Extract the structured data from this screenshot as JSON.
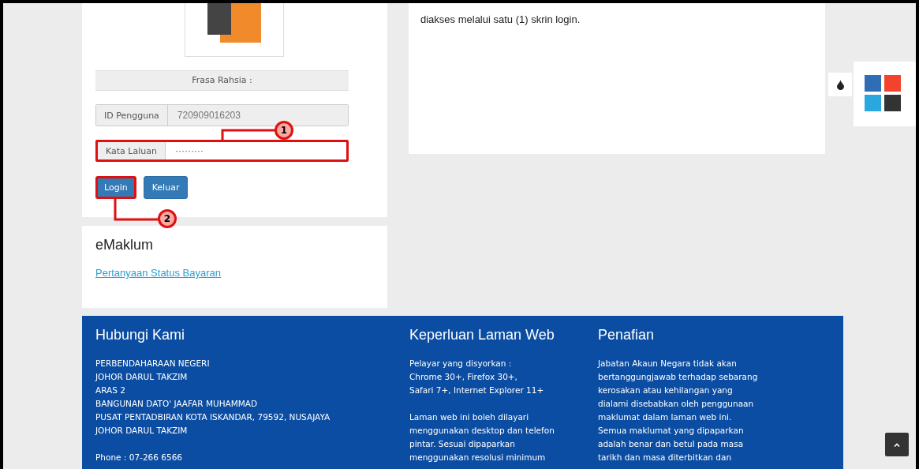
{
  "login": {
    "secret_phrase_label": "Frasa Rahsia :",
    "fields": [
      {
        "label": "ID Pengguna",
        "value": "720909016203",
        "readonly": true,
        "highlighted": false
      },
      {
        "label": "Kata Laluan",
        "value": "·········",
        "readonly": false,
        "highlighted": true,
        "callout": {
          "number": "1",
          "kind": "above"
        }
      }
    ],
    "buttons": [
      {
        "label": "Login",
        "highlighted": true,
        "callout": {
          "number": "2",
          "kind": "below"
        }
      },
      {
        "label": "Keluar",
        "highlighted": false
      }
    ]
  },
  "intro": {
    "text": "diakses melalui satu (1) skrin login."
  },
  "emaklum": {
    "title": "eMaklum",
    "link": "Pertanyaan Status Bayaran"
  },
  "color_switcher": {
    "swatches": [
      {
        "color": "#2f6db5",
        "selected": false
      },
      {
        "color": "#f4432c",
        "selected": false
      },
      {
        "color": "#29a8e0",
        "selected": false
      },
      {
        "color": "#333333",
        "selected": false
      }
    ]
  },
  "footer": {
    "columns": [
      {
        "title": "Hubungi Kami",
        "paragraphs": [
          [
            "PERBENDAHARAAN NEGERI",
            "JOHOR DARUL TAKZIM",
            "ARAS 2",
            "BANGUNAN DATO' JAAFAR MUHAMMAD",
            "PUSAT PENTADBIRAN KOTA ISKANDAR, 79592, NUSAJAYA",
            "JOHOR DARUL TAKZIM"
          ],
          [
            "Phone : 07-266 6566"
          ]
        ]
      },
      {
        "title": "Keperluan Laman Web",
        "paragraphs": [
          [
            "Pelayar yang disyorkan :",
            "Chrome 30+, Firefox 30+,",
            "Safari 7+, Internet Explorer 11+"
          ],
          [
            "Laman web ini boleh dilayari",
            "menggunakan desktop dan telefon",
            "pintar. Sesuai dipaparkan",
            "menggunakan resolusi minimum"
          ]
        ]
      },
      {
        "title": "Penafian",
        "paragraphs": [
          [
            "Jabatan Akaun Negara tidak akan",
            "bertanggungjawab terhadap sebarang",
            "kerosakan atau kehilangan yang",
            "dialami disebabkan oleh penggunaan",
            "maklumat dalam laman web ini.",
            "Semua maklumat yang dipaparkan",
            "adalah benar dan betul pada masa",
            "tarikh dan masa diterbitkan dan"
          ]
        ]
      }
    ]
  }
}
